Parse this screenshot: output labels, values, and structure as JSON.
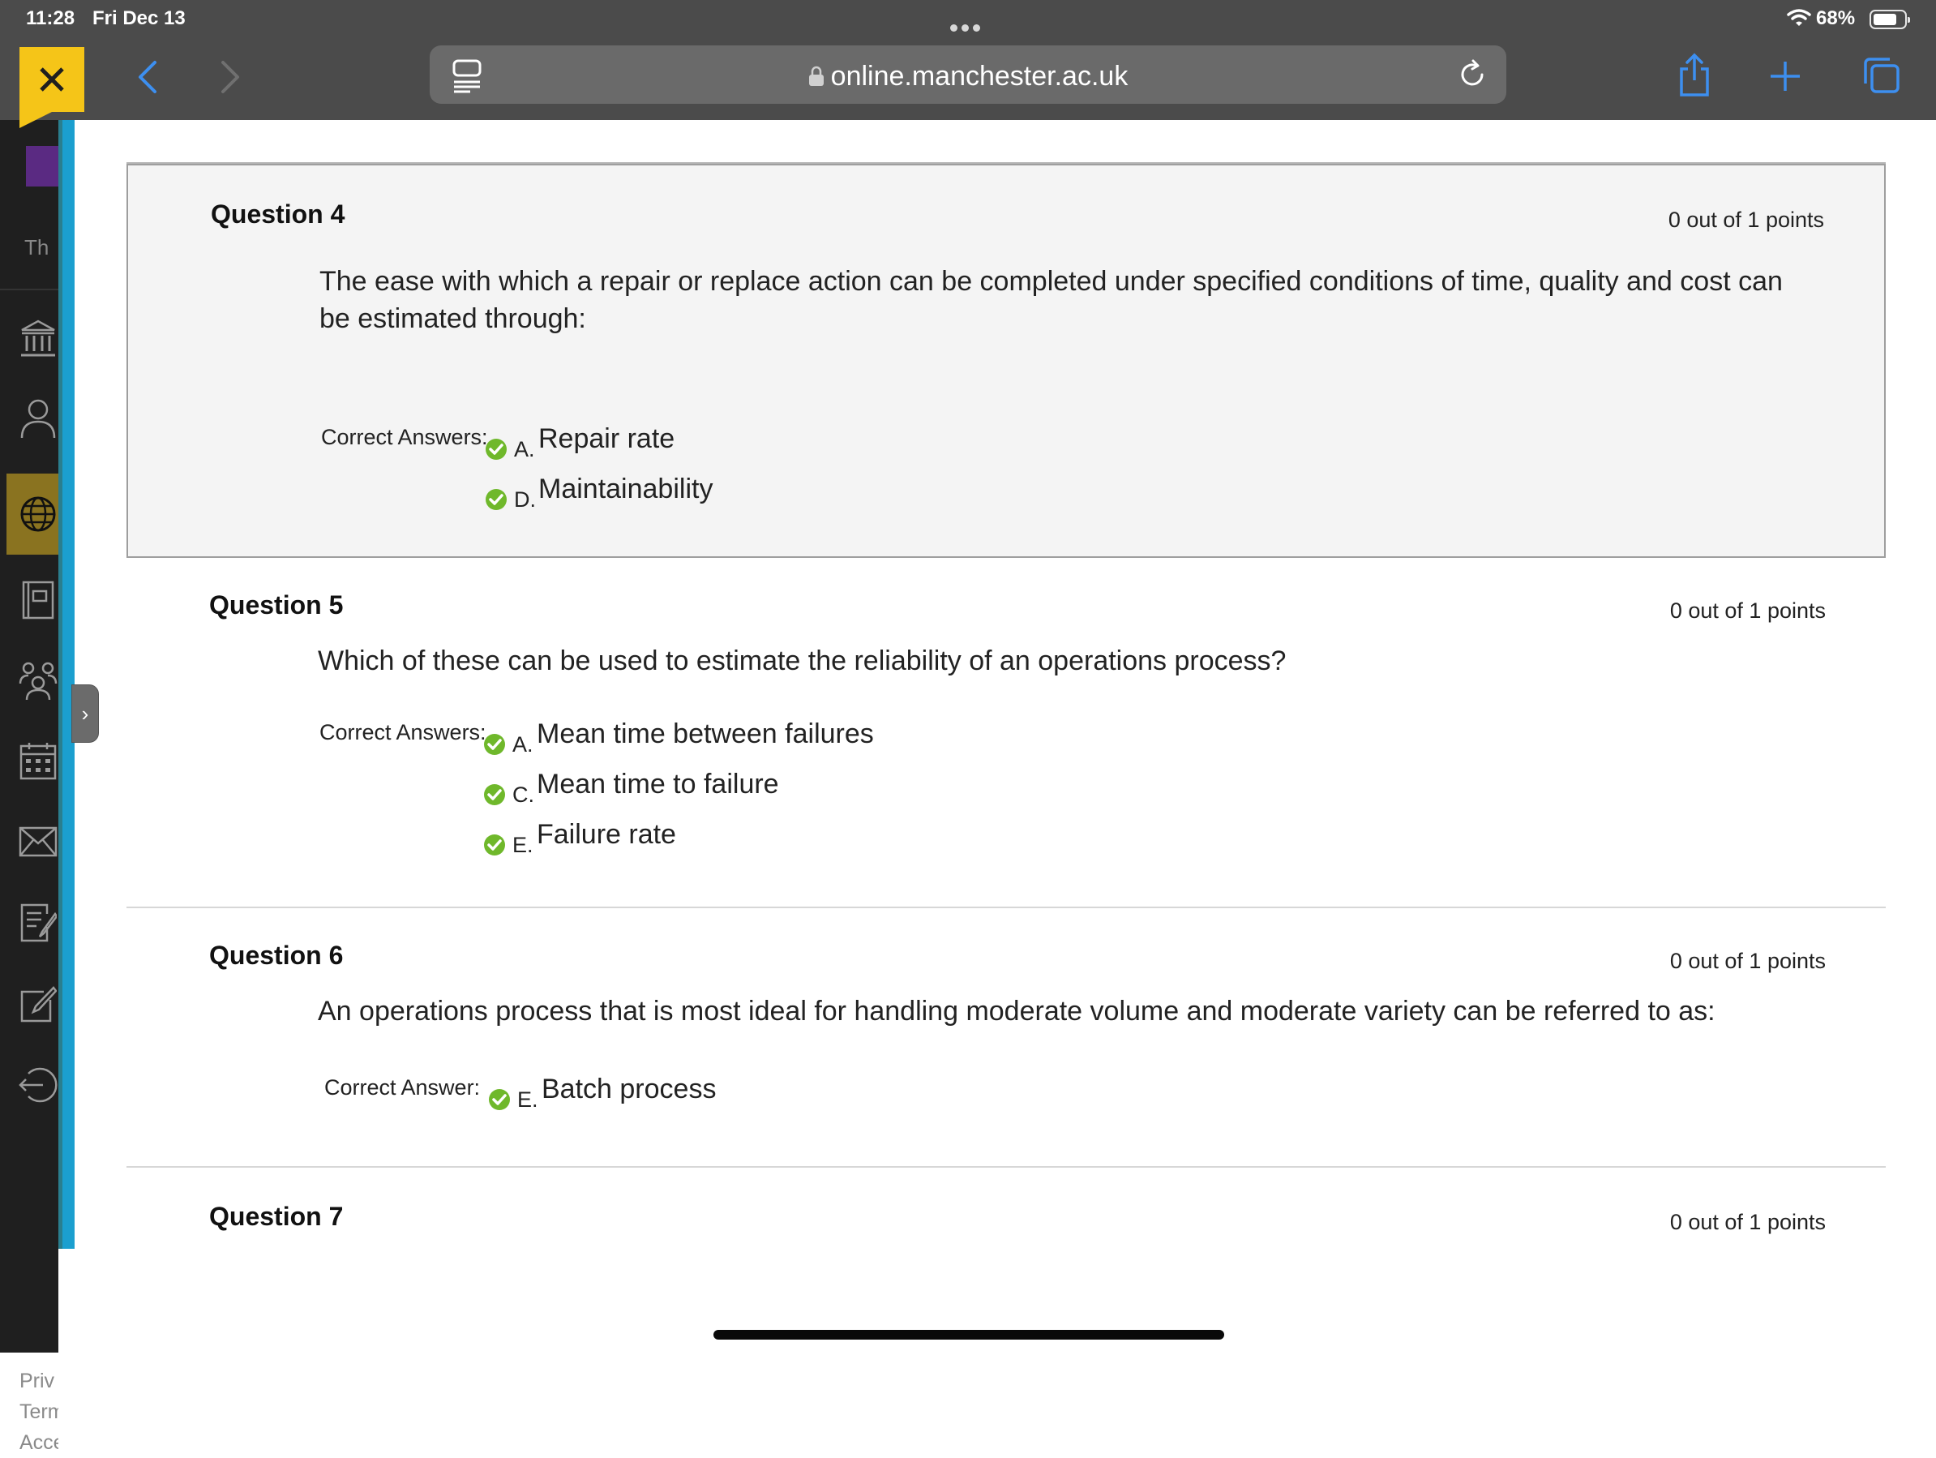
{
  "status_bar": {
    "time": "11:28",
    "date": "Fri Dec 13",
    "battery": "68%"
  },
  "browser": {
    "url": "online.manchester.ac.uk"
  },
  "nav": {
    "logo_fragment": "Th",
    "footer_links": [
      "Priv",
      "Term",
      "Acce"
    ]
  },
  "questions": [
    {
      "title": "Question 4",
      "points": "0 out of 1 points",
      "text": "The ease with which a repair or replace action can be completed under specified conditions of time, quality and cost can be estimated through:",
      "answers_label": "Correct Answers:",
      "answers": [
        {
          "letter": "A.",
          "text": "Repair rate"
        },
        {
          "letter": "D.",
          "text": "Maintainability"
        }
      ]
    },
    {
      "title": "Question 5",
      "points": "0 out of 1 points",
      "text": "Which of these can be used to estimate the reliability of an operations process?",
      "answers_label": "Correct Answers:",
      "answers": [
        {
          "letter": "A.",
          "text": "Mean time between failures"
        },
        {
          "letter": "C.",
          "text": "Mean time to failure"
        },
        {
          "letter": "E.",
          "text": "Failure rate"
        }
      ]
    },
    {
      "title": "Question 6",
      "points": "0 out of 1 points",
      "text": "An operations process that is most ideal for handling moderate volume and moderate variety can be referred to as:",
      "answers_label": "Correct Answer:",
      "answers": [
        {
          "letter": "E.",
          "text": "Batch process"
        }
      ]
    },
    {
      "title": "Question 7",
      "points": "0 out of 1 points"
    }
  ],
  "colors": {
    "accent_yellow": "#f5c518",
    "nav_accent": "#1b9fcf",
    "check_green": "#6fb82b"
  },
  "icons": [
    "sidebar-icon",
    "back-icon",
    "forward-icon",
    "reader-icon",
    "lock-icon",
    "reload-icon",
    "share-icon",
    "plus-icon",
    "tabs-icon",
    "close-icon",
    "institution-icon",
    "profile-icon",
    "globe-icon",
    "courses-icon",
    "groups-icon",
    "calendar-icon",
    "messages-icon",
    "grades-icon",
    "edit-icon",
    "sign-out-icon",
    "check-icon"
  ]
}
